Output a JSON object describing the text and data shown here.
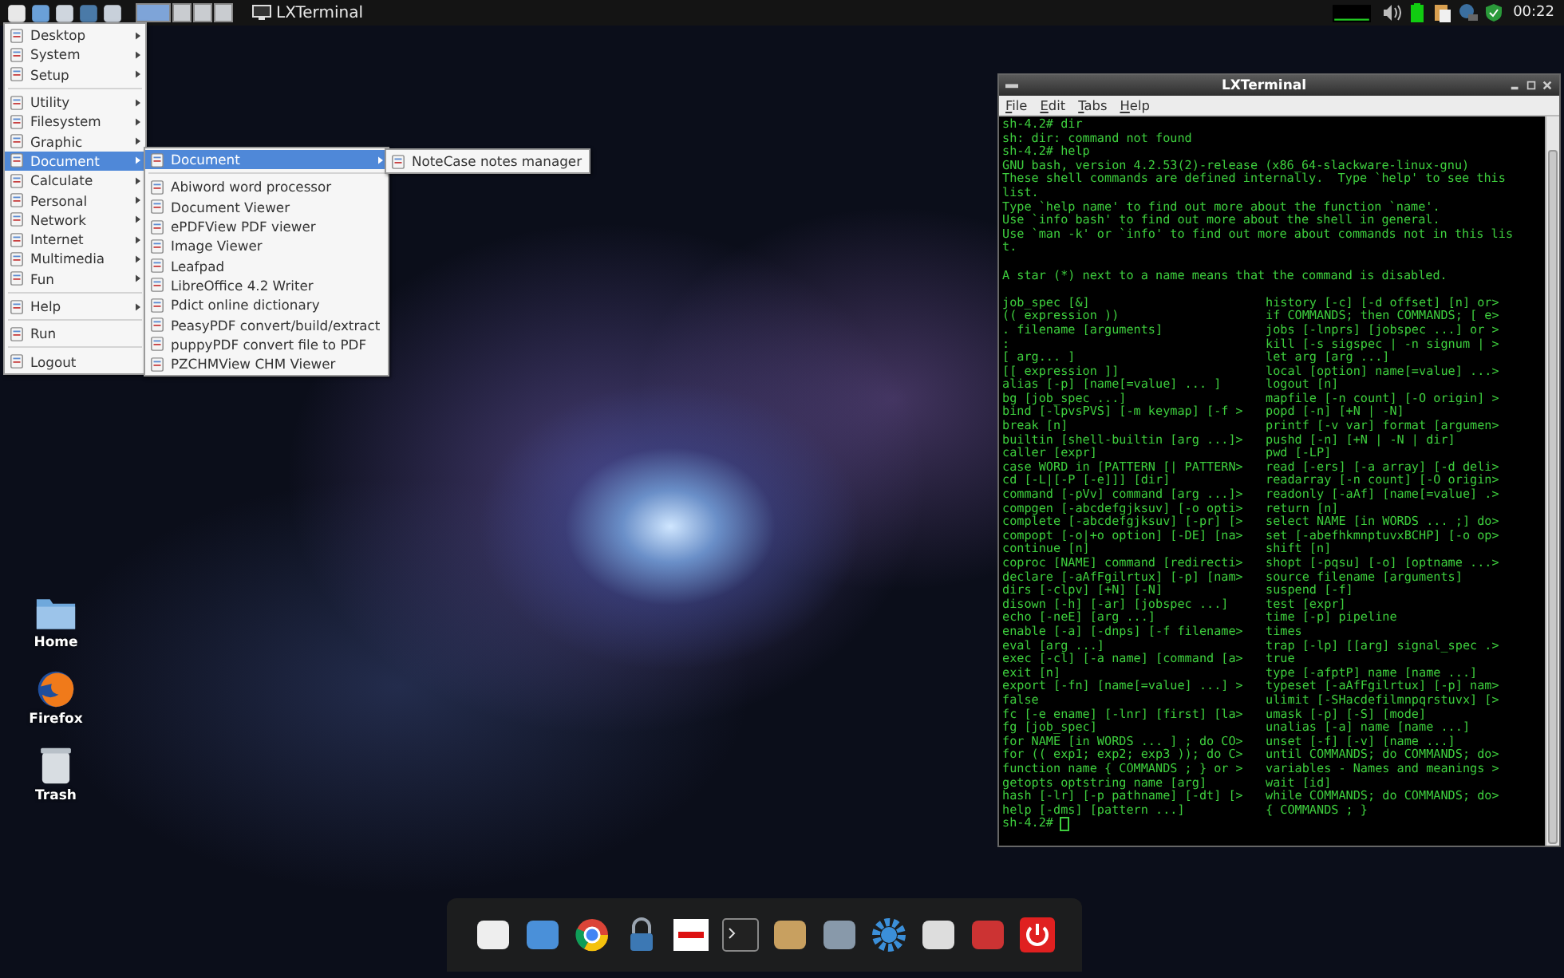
{
  "top_panel": {
    "workspaces": [
      {
        "selected": true
      },
      {
        "selected": false
      },
      {
        "selected": false
      },
      {
        "selected": false
      }
    ],
    "tasks": [
      {
        "label": "LXTerminal",
        "selected": false
      }
    ],
    "clock": "00:22"
  },
  "main_menu": [
    {
      "kind": "item",
      "label": "Desktop",
      "submenu": true,
      "selected": false
    },
    {
      "kind": "item",
      "label": "System",
      "submenu": true,
      "selected": false
    },
    {
      "kind": "item",
      "label": "Setup",
      "submenu": true,
      "selected": false
    },
    {
      "kind": "separator"
    },
    {
      "kind": "item",
      "label": "Utility",
      "submenu": true,
      "selected": false
    },
    {
      "kind": "item",
      "label": "Filesystem",
      "submenu": true,
      "selected": false
    },
    {
      "kind": "item",
      "label": "Graphic",
      "submenu": true,
      "selected": false
    },
    {
      "kind": "item",
      "label": "Document",
      "submenu": true,
      "selected": true
    },
    {
      "kind": "item",
      "label": "Calculate",
      "submenu": true,
      "selected": false
    },
    {
      "kind": "item",
      "label": "Personal",
      "submenu": true,
      "selected": false
    },
    {
      "kind": "item",
      "label": "Network",
      "submenu": true,
      "selected": false
    },
    {
      "kind": "item",
      "label": "Internet",
      "submenu": true,
      "selected": false
    },
    {
      "kind": "item",
      "label": "Multimedia",
      "submenu": true,
      "selected": false
    },
    {
      "kind": "item",
      "label": "Fun",
      "submenu": true,
      "selected": false
    },
    {
      "kind": "separator"
    },
    {
      "kind": "item",
      "label": "Help",
      "submenu": true,
      "selected": false
    },
    {
      "kind": "separator"
    },
    {
      "kind": "item",
      "label": "Run",
      "submenu": false,
      "selected": false
    },
    {
      "kind": "separator"
    },
    {
      "kind": "item",
      "label": "Logout",
      "submenu": false,
      "selected": false
    }
  ],
  "document_menu": [
    {
      "kind": "item",
      "label": "Document",
      "submenu": true,
      "selected": true
    },
    {
      "kind": "separator"
    },
    {
      "kind": "item",
      "label": "Abiword word processor",
      "submenu": false,
      "selected": false
    },
    {
      "kind": "item",
      "label": "Document Viewer",
      "submenu": false,
      "selected": false
    },
    {
      "kind": "item",
      "label": "ePDFView PDF viewer",
      "submenu": false,
      "selected": false
    },
    {
      "kind": "item",
      "label": "Image Viewer",
      "submenu": false,
      "selected": false
    },
    {
      "kind": "item",
      "label": "Leafpad",
      "submenu": false,
      "selected": false
    },
    {
      "kind": "item",
      "label": "LibreOffice 4.2 Writer",
      "submenu": false,
      "selected": false
    },
    {
      "kind": "item",
      "label": "Pdict online dictionary",
      "submenu": false,
      "selected": false
    },
    {
      "kind": "item",
      "label": "PeasyPDF convert/build/extract",
      "submenu": false,
      "selected": false
    },
    {
      "kind": "item",
      "label": "puppyPDF convert file to PDF",
      "submenu": false,
      "selected": false
    },
    {
      "kind": "item",
      "label": "PZCHMView CHM Viewer",
      "submenu": false,
      "selected": false
    }
  ],
  "document_submenu": [
    {
      "kind": "item",
      "label": "NoteCase notes manager",
      "submenu": false,
      "selected": false
    }
  ],
  "desktop_icons": [
    {
      "label": "Home",
      "kind": "folder"
    },
    {
      "label": "Firefox",
      "kind": "browser"
    },
    {
      "label": "Trash",
      "kind": "trash"
    }
  ],
  "terminal": {
    "title": "LXTerminal",
    "menu": [
      "File",
      "Edit",
      "Tabs",
      "Help"
    ],
    "intro": [
      [
        "sh-4.2# dir",
        "sh: dir: command not found",
        "sh-4.2# help",
        "GNU bash, version 4.2.53(2)-release (x86_64-slackware-linux-gnu)",
        "These shell commands are defined internally.  Type `help' to see this",
        "list.",
        "Type `help name' to find out more about the function `name'.",
        "Use `info bash' to find out more about the shell in general.",
        "Use `man -k' or `info' to find out more about commands not in this lis",
        "t."
      ],
      [
        "A star (*) next to a name means that the command is disabled."
      ]
    ],
    "column_1": [
      "job_spec [&]",
      "(( expression ))",
      ". filename [arguments]",
      ":",
      "[ arg... ]",
      "[[ expression ]]",
      "alias [-p] [name[=value] ... ]",
      "bg [job_spec ...]",
      "bind [-lpvsPVS] [-m keymap] [-f >",
      "break [n]",
      "builtin [shell-builtin [arg ...]>",
      "caller [expr]",
      "case WORD in [PATTERN [| PATTERN>",
      "cd [-L|[-P [-e]]] [dir]",
      "command [-pVv] command [arg ...]>",
      "compgen [-abcdefgjksuv] [-o opti>",
      "complete [-abcdefgjksuv] [-pr] [>",
      "compopt [-o|+o option] [-DE] [na>",
      "continue [n]",
      "coproc [NAME] command [redirecti>",
      "declare [-aAfFgilrtux] [-p] [nam>",
      "dirs [-clpv] [+N] [-N]",
      "disown [-h] [-ar] [jobspec ...]",
      "echo [-neE] [arg ...]",
      "enable [-a] [-dnps] [-f filename>",
      "eval [arg ...]",
      "exec [-cl] [-a name] [command [a>",
      "exit [n]",
      "export [-fn] [name[=value] ...] >",
      "false",
      "fc [-e ename] [-lnr] [first] [la>",
      "fg [job_spec]",
      "for NAME [in WORDS ... ] ; do CO>",
      "for (( exp1; exp2; exp3 )); do C>",
      "function name { COMMANDS ; } or >",
      "getopts optstring name [arg]",
      "hash [-lr] [-p pathname] [-dt] [>",
      "help [-dms] [pattern ...]"
    ],
    "column_2": [
      "history [-c] [-d offset] [n] or>",
      "if COMMANDS; then COMMANDS; [ e>",
      "jobs [-lnprs] [jobspec ...] or >",
      "kill [-s sigspec | -n signum | >",
      "let arg [arg ...]",
      "local [option] name[=value] ...>",
      "logout [n]",
      "mapfile [-n count] [-O origin] >",
      "popd [-n] [+N | -N]",
      "printf [-v var] format [argumen>",
      "pushd [-n] [+N | -N | dir]",
      "pwd [-LP]",
      "read [-ers] [-a array] [-d deli>",
      "readarray [-n count] [-O origin>",
      "readonly [-aAf] [name[=value] .>",
      "return [n]",
      "select NAME [in WORDS ... ;] do>",
      "set [-abefhkmnptuvxBCHP] [-o op>",
      "shift [n]",
      "shopt [-pqsu] [-o] [optname ...>",
      "source filename [arguments]",
      "suspend [-f]",
      "test [expr]",
      "time [-p] pipeline",
      "times",
      "trap [-lp] [[arg] signal_spec .>",
      "true",
      "type [-afptP] name [name ...]",
      "typeset [-aAfFgilrtux] [-p] nam>",
      "ulimit [-SHacdefilmnpqrstuvx] [>",
      "umask [-p] [-S] [mode]",
      "unalias [-a] name [name ...]",
      "unset [-f] [-v] [name ...]",
      "until COMMANDS; do COMMANDS; do>",
      "variables - Names and meanings >",
      "wait [id]",
      "while COMMANDS; do COMMANDS; do>",
      "{ COMMANDS ; }"
    ],
    "prompt": "sh-4.2#"
  }
}
